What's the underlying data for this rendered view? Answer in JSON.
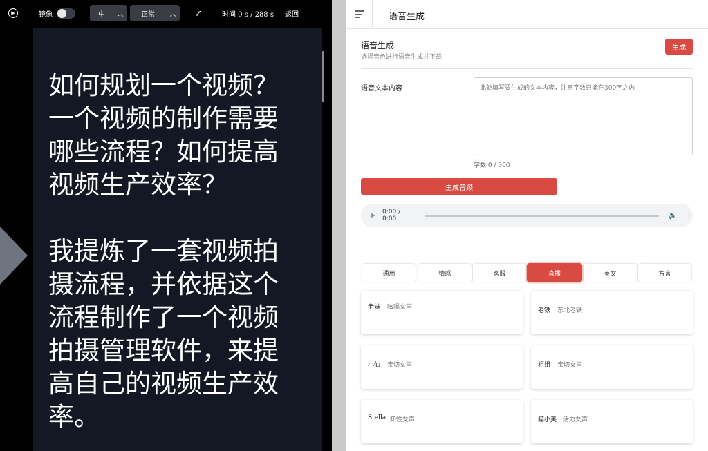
{
  "toolbar": {
    "mirror_label": "镜像",
    "size_value": "中",
    "speed_value": "正常",
    "time_text": "时间  0 s / 288 s",
    "back_label": "返回"
  },
  "prompter": {
    "paragraphs": [
      "如何规划一个视频？一个视频的制作需要哪些流程？如何提高视频生产效率？",
      "我提炼了一套视频拍摄流程，并依据这个流程制作了一个视频拍摄管理软件，来提高自己的视频生产效率。"
    ]
  },
  "header": {
    "title": "语音生成"
  },
  "section": {
    "title": "语音生成",
    "subtitle": "选择音色进行语音生成并下载",
    "generate_label": "生成"
  },
  "form": {
    "text_label": "语音文本内容",
    "placeholder": "此处填写要生成的文本内容，注意字数只能在300字之内",
    "count_text": "字数 0 / 300",
    "audio_button": "生成音频"
  },
  "player": {
    "time": "0:00 / 0:00"
  },
  "tabs": [
    {
      "label": "通用"
    },
    {
      "label": "情感"
    },
    {
      "label": "客服"
    },
    {
      "label": "直播"
    },
    {
      "label": "英文"
    },
    {
      "label": "方言"
    }
  ],
  "active_tab": "直播",
  "voices": [
    {
      "name": "老妹",
      "desc": "吆喝女声"
    },
    {
      "name": "老铁",
      "desc": "东北老铁"
    },
    {
      "name": "小仙",
      "desc": "亲切女声"
    },
    {
      "name": "柜姐",
      "desc": "亲切女声"
    },
    {
      "name": "Stella",
      "desc": "知性女声"
    },
    {
      "name": "猫小美",
      "desc": "活力女声"
    }
  ],
  "colors": {
    "accent": "#d94a42",
    "prompter_bg": "#141824"
  }
}
